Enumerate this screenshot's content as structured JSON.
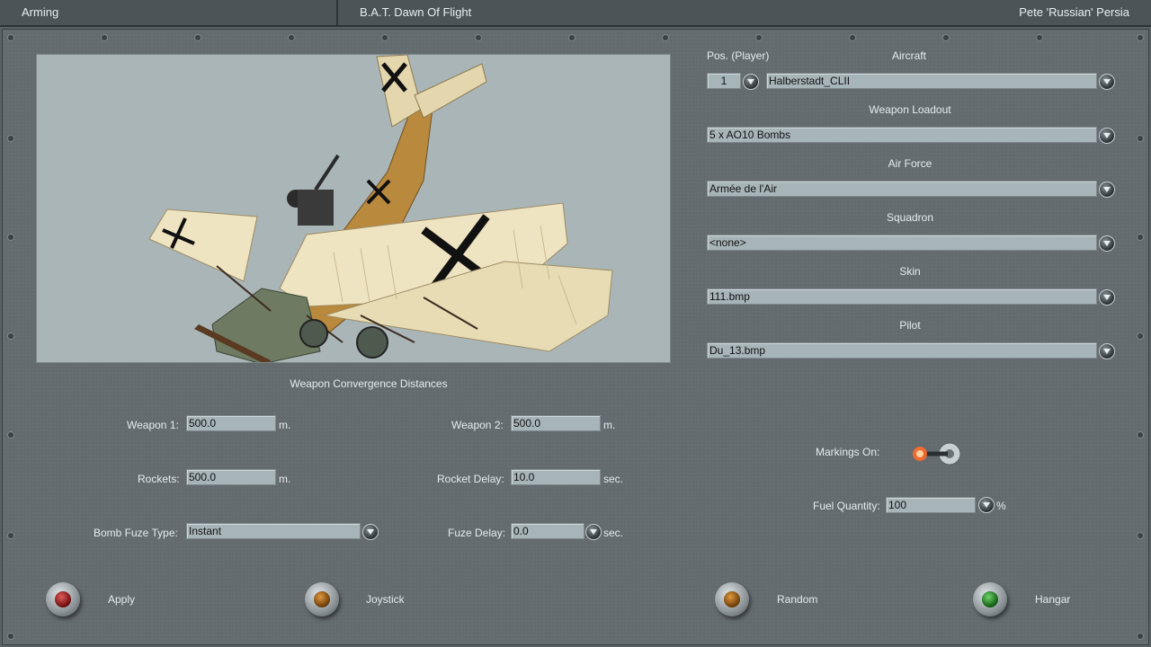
{
  "titlebar": {
    "section": "Arming",
    "title": "B.A.T. Dawn Of Flight",
    "user": "Pete 'Russian' Persia"
  },
  "right": {
    "pos_label": "Pos. (Player)",
    "pos_value": "1",
    "aircraft_label": "Aircraft",
    "aircraft_value": "Halberstadt_CLII",
    "loadout_label": "Weapon Loadout",
    "loadout_value": "5 x AO10 Bombs",
    "airforce_label": "Air Force",
    "airforce_value": "Armée de l'Air",
    "squadron_label": "Squadron",
    "squadron_value": "<none>",
    "skin_label": "Skin",
    "skin_value": "111.bmp",
    "pilot_label": "Pilot",
    "pilot_value": "Du_13.bmp",
    "markings_label": "Markings On:",
    "fuel_label": "Fuel Quantity:",
    "fuel_value": "100",
    "fuel_unit": "%"
  },
  "convergence": {
    "title": "Weapon Convergence Distances",
    "weapon1_label": "Weapon 1:",
    "weapon1_value": "500.0",
    "weapon1_unit": "m.",
    "weapon2_label": "Weapon 2:",
    "weapon2_value": "500.0",
    "weapon2_unit": "m.",
    "rockets_label": "Rockets:",
    "rockets_value": "500.0",
    "rockets_unit": "m.",
    "rocket_delay_label": "Rocket Delay:",
    "rocket_delay_value": "10.0",
    "rocket_delay_unit": "sec.",
    "bomb_fuze_label": "Bomb Fuze Type:",
    "bomb_fuze_value": "Instant",
    "fuze_delay_label": "Fuze Delay:",
    "fuze_delay_value": "0.0",
    "fuze_delay_unit": "sec."
  },
  "buttons": {
    "apply": "Apply",
    "joystick": "Joystick",
    "random": "Random",
    "hangar": "Hangar"
  },
  "colors": {
    "panel": "#646b6f",
    "field": "#a7b4b8",
    "markings_lamp": "#ff6a2a"
  }
}
